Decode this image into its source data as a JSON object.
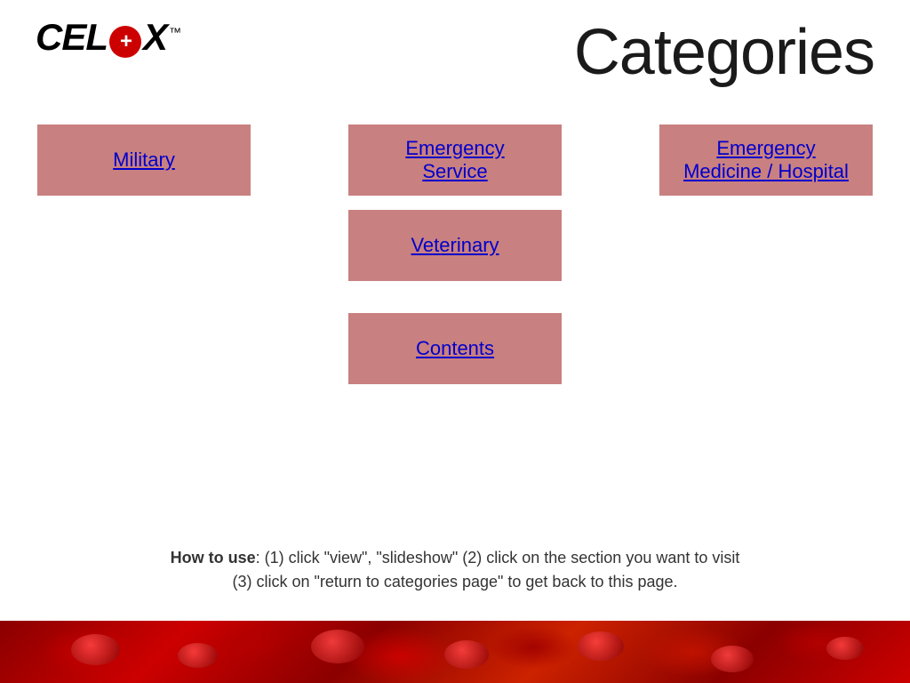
{
  "header": {
    "logo_text_before": "CEL",
    "logo_text_after": "X",
    "logo_tm": "™",
    "page_title": "Categories"
  },
  "categories": {
    "row1": [
      {
        "id": "military",
        "label": "Military"
      },
      {
        "id": "emergency-service",
        "label": "Emergency\nService"
      },
      {
        "id": "emergency-medicine",
        "label": "Emergency\nMedicine / Hospital"
      }
    ],
    "row2": [
      {
        "id": "veterinary",
        "label": "Veterinary"
      }
    ],
    "row3": [
      {
        "id": "contents",
        "label": "Contents"
      }
    ]
  },
  "instructions": {
    "bold_part": "How to use",
    "text": ": (1) click “view”, “slideshow” (2) click on the section you want to visit\n(3) click on “return to categories page” to get back to this page."
  }
}
